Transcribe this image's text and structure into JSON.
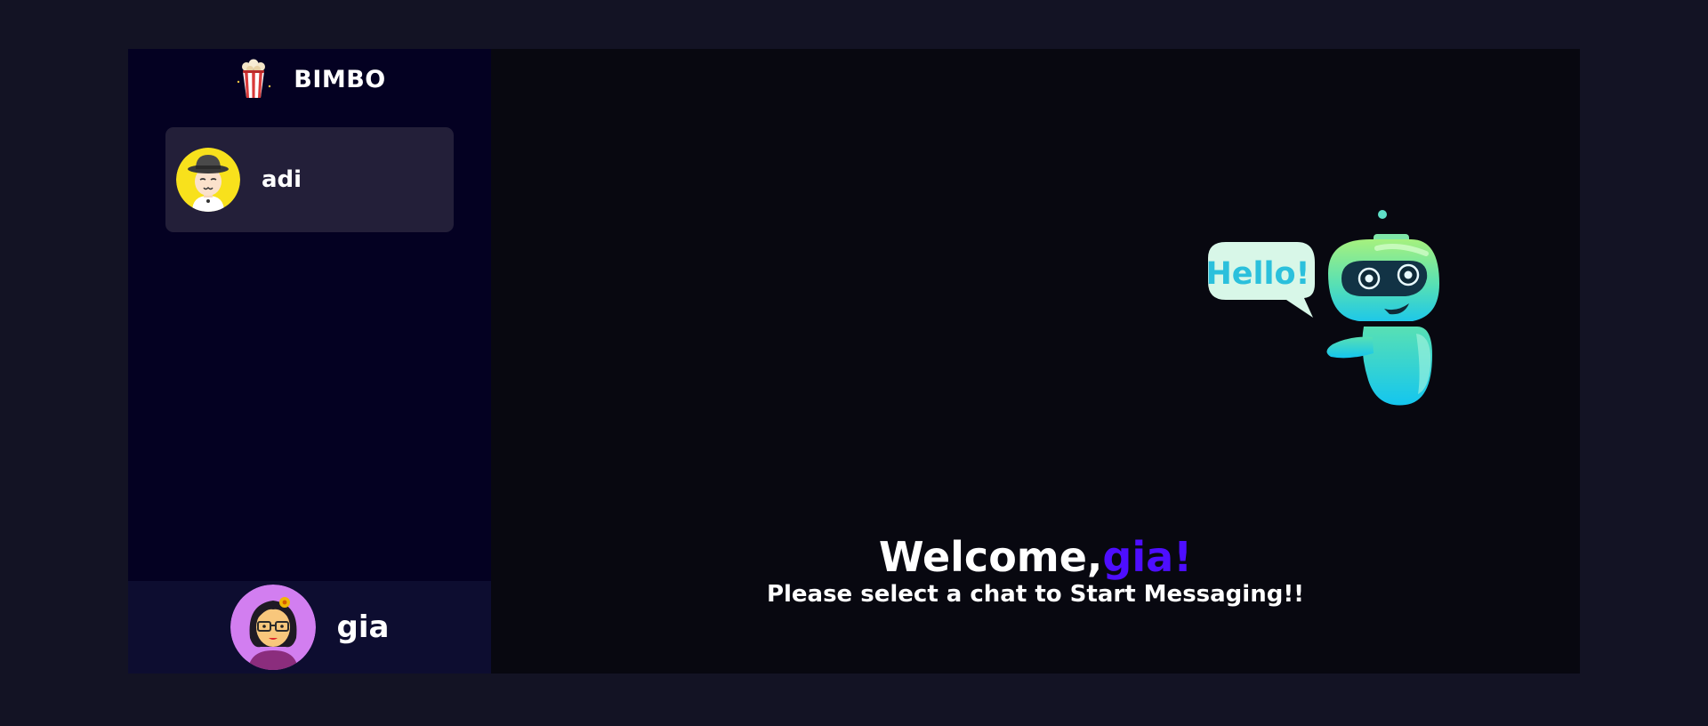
{
  "brand": {
    "name": "BIMBO",
    "logo_icon": "popcorn-icon"
  },
  "contacts": [
    {
      "name": "adi",
      "avatar_icon": "man-with-hat-avatar-icon",
      "selected": false
    }
  ],
  "current_user": {
    "name": "gia",
    "avatar_icon": "woman-with-glasses-avatar-icon"
  },
  "welcome": {
    "prefix": "Welcome,",
    "username": "gia!",
    "subtitle": "Please select a chat to Start Messaging!!",
    "robot_bubble_text": "Hello!"
  },
  "colors": {
    "page_bg": "#131324",
    "sidebar_bg": "#040122",
    "contact_bg": "#231f39",
    "current_user_bg": "#0d0d30",
    "main_bg": "#080810",
    "accent": "#4e0eff"
  }
}
